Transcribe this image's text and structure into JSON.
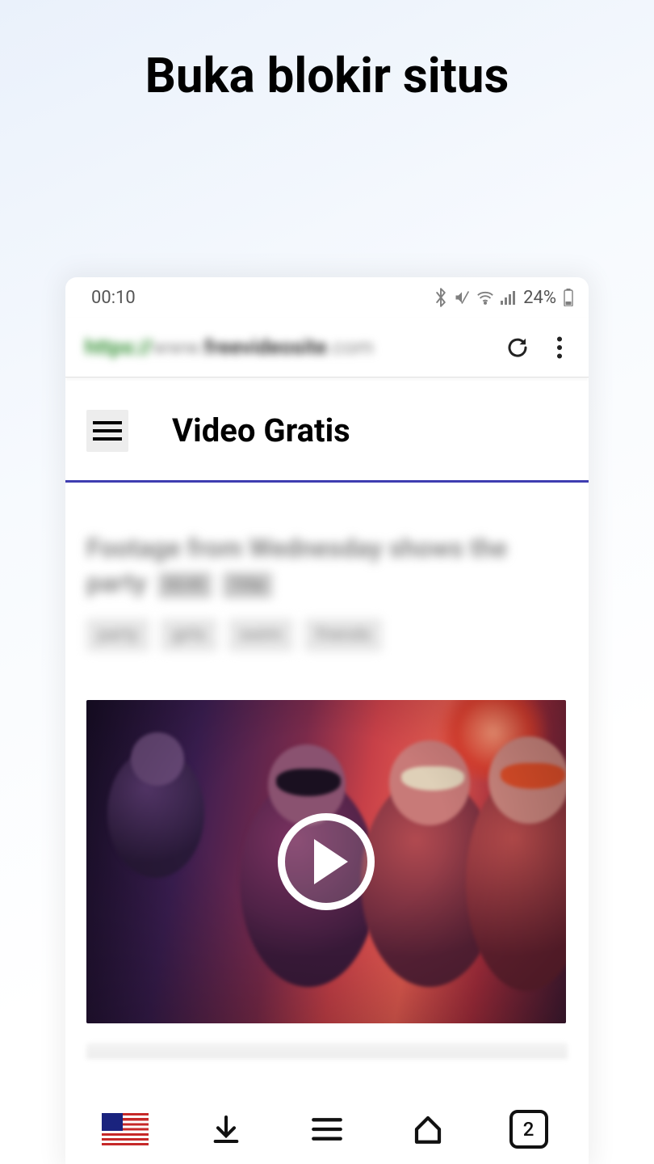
{
  "page_title": "Buka blokir situs",
  "status": {
    "time": "00:10",
    "battery_text": "24%"
  },
  "address_bar": {
    "scheme": "https://",
    "host_sub": "www.",
    "host_main": "freevideosite",
    "host_tld": ".com"
  },
  "site": {
    "title": "Video Gratis"
  },
  "content": {
    "headline": "Footage from Wednesday shows the party",
    "badges": [
      "02:45",
      "720p"
    ],
    "tags": [
      "party",
      "girls",
      "swim",
      "friends"
    ]
  },
  "bottom": {
    "tab_count": "2"
  }
}
